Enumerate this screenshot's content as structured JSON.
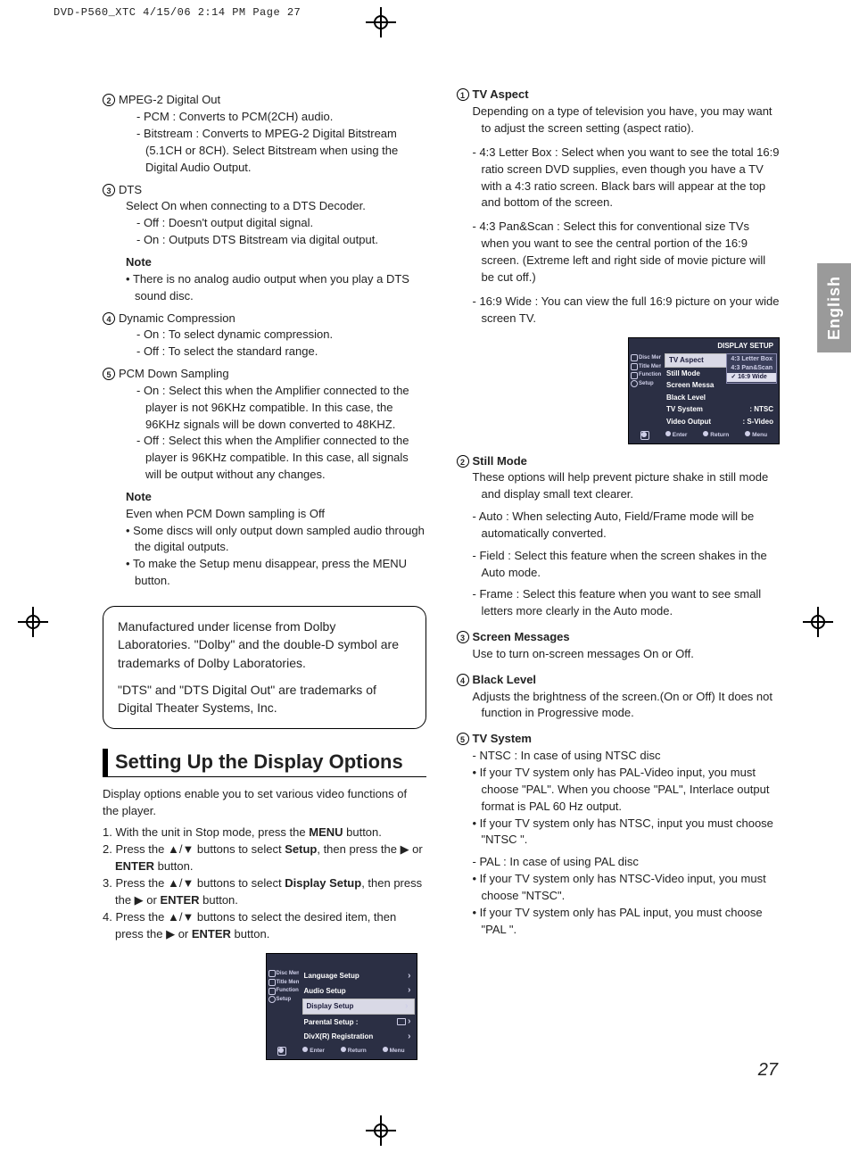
{
  "slug": "DVD-P560_XTC  4/15/06  2:14 PM  Page 27",
  "tab": "English",
  "pageNumber": "27",
  "left": {
    "i2": {
      "num": "2",
      "title": "MPEG-2 Digital Out",
      "l1": "- PCM : Converts to PCM(2CH) audio.",
      "l2": "- Bitstream : Converts to MPEG-2 Digital Bitstream (5.1CH or 8CH). Select Bitstream when using the Digital Audio Output."
    },
    "i3": {
      "num": "3",
      "title": "DTS",
      "lead": "Select On when connecting to a DTS Decoder.",
      "a": "- Off : Doesn't output digital signal.",
      "b": "- On : Outputs DTS Bitstream via digital output.",
      "noteLabel": "Note",
      "note1": "There is no analog audio output when you play a DTS sound disc."
    },
    "i4": {
      "num": "4",
      "title": "Dynamic Compression",
      "a": "- On : To select dynamic compression.",
      "b": "- Off : To select the standard range."
    },
    "i5": {
      "num": "5",
      "title": "PCM Down Sampling",
      "a": "- On : Select this when the Amplifier connected to the player is not 96KHz compatible. In this case, the 96KHz signals will be down converted to 48KHZ.",
      "b": "- Off : Select this when the Amplifier connected to the player is 96KHz compatible. In this case, all signals will be output without any changes.",
      "noteLabel": "Note",
      "noteLead": "Even when PCM Down sampling is Off",
      "n1": "Some discs will only output down sampled audio through the digital outputs.",
      "n2": "To make the Setup menu disappear, press the MENU button."
    },
    "license": {
      "p1": "Manufactured under license from Dolby Laboratories. \"Dolby\" and the double-D symbol are trademarks of Dolby Laboratories.",
      "p2": "\"DTS\" and \"DTS Digital Out\" are trademarks of Digital Theater Systems, Inc."
    },
    "section": "Setting Up the Display Options",
    "intro": "Display options enable you to set various video functions of the player.",
    "s1a": "1. With the unit in Stop mode, press the ",
    "s1b": "MENU",
    "s1c": " button.",
    "s2a": "2. Press the ▲/▼ buttons to select ",
    "s2b": "Setup",
    "s2c": ", then press the ▶ or ",
    "s2d": "ENTER",
    "s2e": " button.",
    "s3a": "3. Press the ▲/▼ buttons to select ",
    "s3b": "Display Setup",
    "s3c": ", then press the ▶ or ",
    "s3d": "ENTER",
    "s3e": " button.",
    "s4a": "4. Press the ▲/▼ buttons to select the desired item, then press the ▶ or ",
    "s4b": "ENTER",
    "s4c": " button.",
    "osd1": {
      "side": {
        "a": "Disc Menu",
        "b": "Title Menu",
        "c": "Function",
        "d": "Setup"
      },
      "r1": "Language Setup",
      "r2": "Audio Setup",
      "r3": "Display Setup",
      "r4": "Parental Setup :",
      "r5": "DivX(R) Registration",
      "f1": "Enter",
      "f2": "Return",
      "f3": "Menu"
    }
  },
  "right": {
    "i1": {
      "num": "1",
      "title": "TV Aspect",
      "lead": "Depending on a type of television you have, you may want to adjust the screen setting (aspect ratio).",
      "a": "- 4:3 Letter Box : Select when you want to see the total 16:9 ratio screen DVD supplies, even though you have a TV with a 4:3 ratio screen. Black bars will appear at the top and bottom of the screen.",
      "b": "- 4:3 Pan&Scan : Select this for conventional size TVs when you want to see the central portion of the 16:9 screen. (Extreme left and right side of movie picture will be cut off.)",
      "c": "- 16:9 Wide : You can view the full 16:9 picture on your wide screen TV."
    },
    "osd2": {
      "title": "DISPLAY SETUP",
      "side": {
        "a": "Disc Menu",
        "b": "Title Menu",
        "c": "Function",
        "d": "Setup"
      },
      "rows": {
        "r1": "TV Aspect",
        "r2": "Still Mode",
        "r3": "Screen Messa",
        "r4": "Black Level",
        "r5": "TV System",
        "r6": "Video Output"
      },
      "vals": {
        "v5": ": NTSC",
        "v6": ": S-Video"
      },
      "opts": {
        "o1": "4:3 Letter Box",
        "o2": "4:3 Pan&Scan",
        "o3": "16:9 Wide"
      },
      "f1": "Enter",
      "f2": "Return",
      "f3": "Menu"
    },
    "i2": {
      "num": "2",
      "title": "Still Mode",
      "lead": "These options will help prevent picture shake in still mode and display small text clearer.",
      "a": "- Auto : When selecting Auto, Field/Frame mode will be automatically converted.",
      "b": "- Field : Select this feature when the screen shakes in the Auto mode.",
      "c": "- Frame : Select this feature when you want to see small letters more clearly in the Auto mode."
    },
    "i3": {
      "num": "3",
      "title": "Screen Messages",
      "lead": "Use to turn on-screen messages On or Off."
    },
    "i4": {
      "num": "4",
      "title": "Black Level",
      "lead": "Adjusts the brightness of the screen.(On or Off) It does not function in Progressive mode."
    },
    "i5": {
      "num": "5",
      "title": "TV System",
      "a": "- NTSC : In case of using NTSC disc",
      "b1": "If your TV system only has PAL-Video input, you must choose \"PAL\". When you choose \"PAL\", Interlace output format is PAL 60 Hz output.",
      "b2": "If your TV system only has NTSC, input you must choose \"NTSC \".",
      "c": "- PAL : In case of using PAL disc",
      "b3": "If your TV system only has NTSC-Video input, you must choose \"NTSC\".",
      "b4": "If your TV system only has PAL input, you must choose \"PAL \"."
    }
  }
}
